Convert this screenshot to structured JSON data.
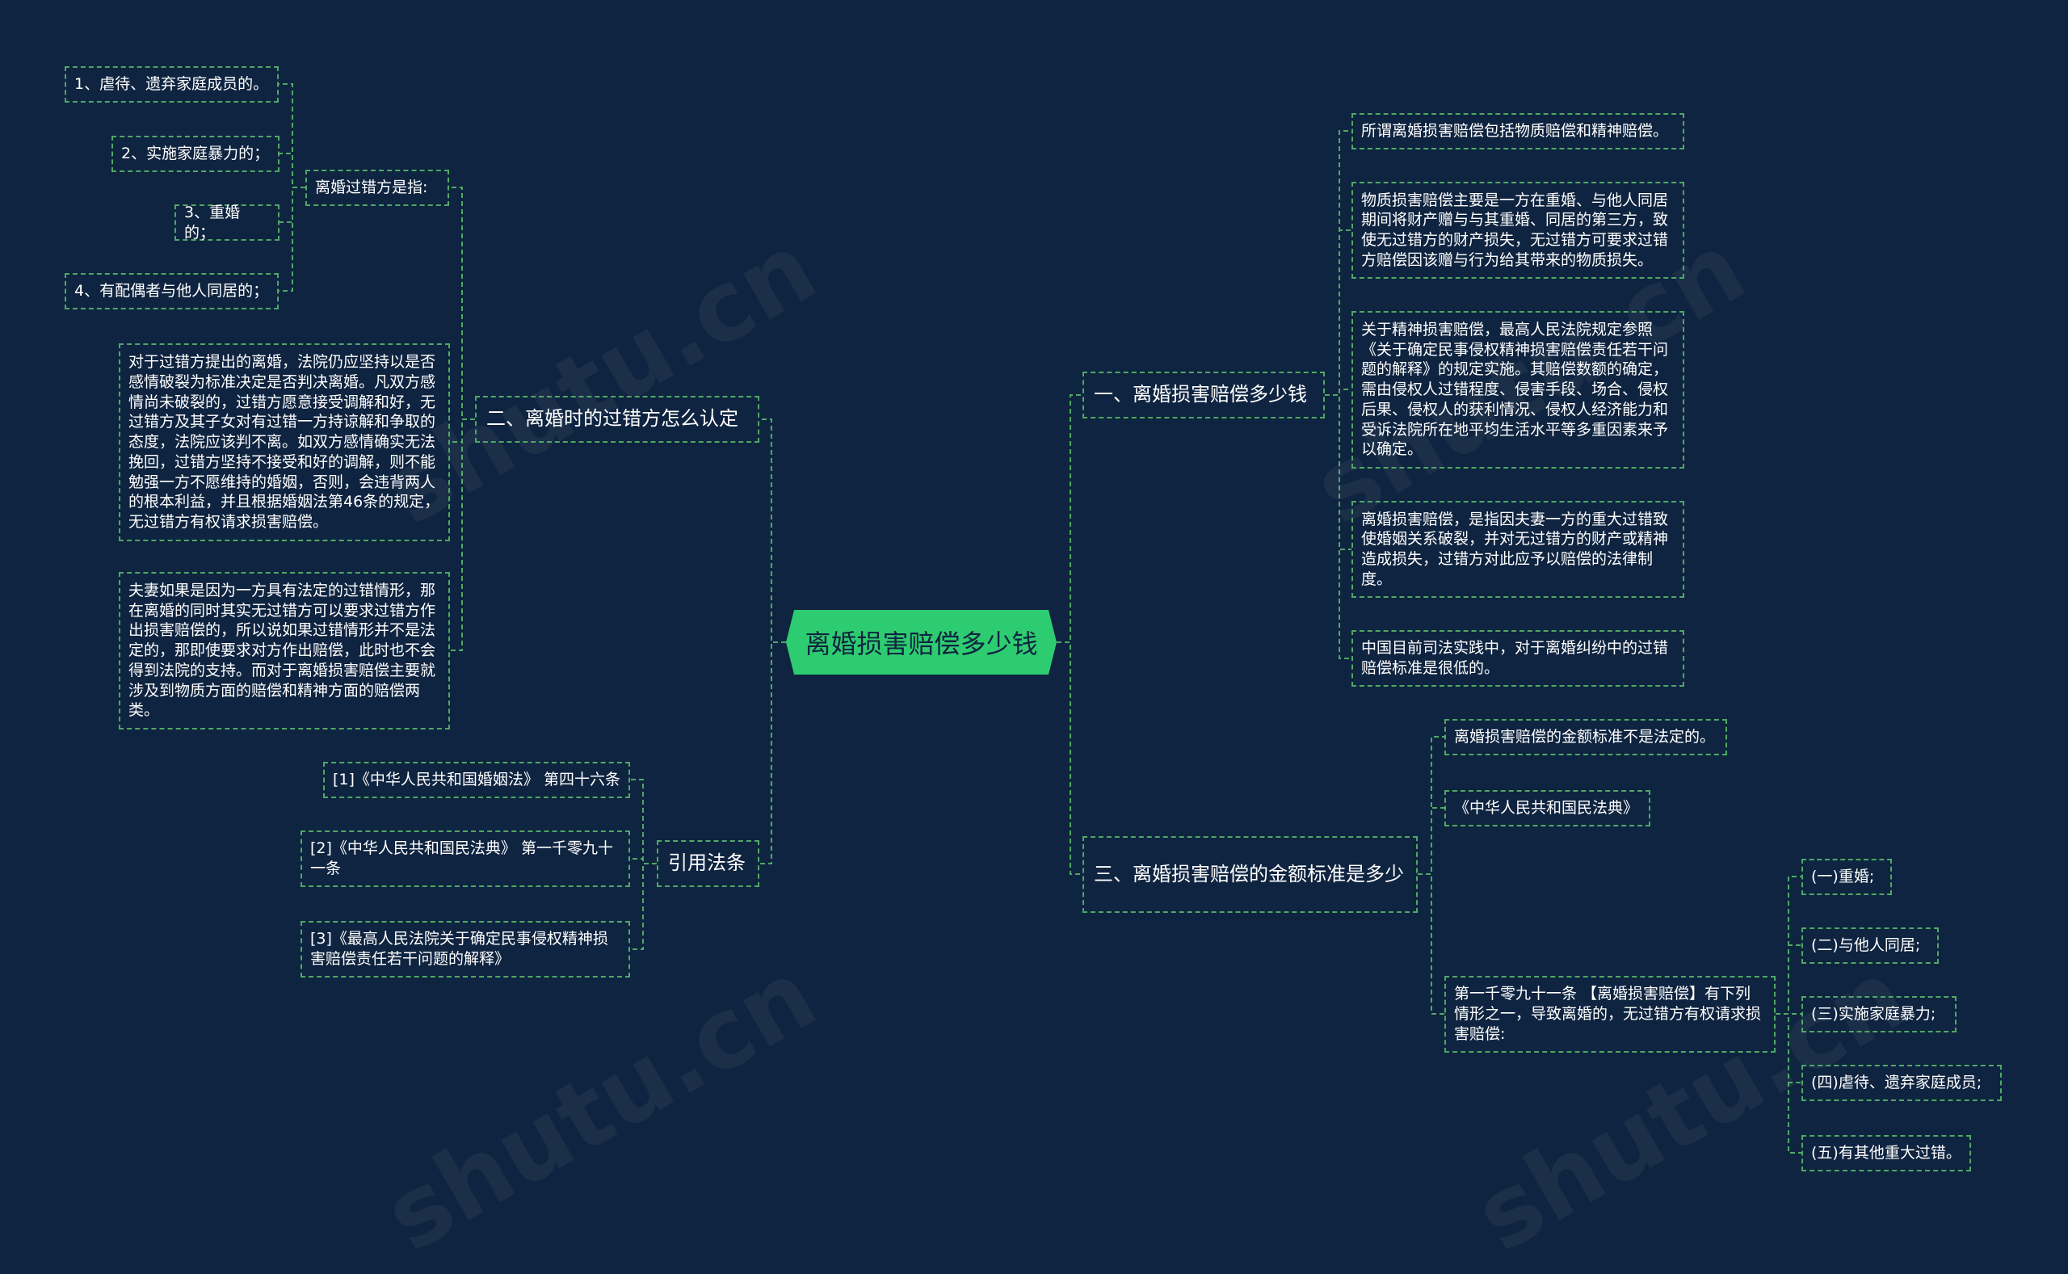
{
  "root": {
    "label": "离婚损害赔偿多少钱"
  },
  "branches": {
    "b1": {
      "label": "一、离婚损害赔偿多少钱",
      "children": [
        "所谓离婚损害赔偿包括物质赔偿和精神赔偿。",
        "物质损害赔偿主要是一方在重婚、与他人同居期间将财产赠与与其重婚、同居的第三方，致使无过错方的财产损失，无过错方可要求过错方赔偿因该赠与行为给其带来的物质损失。",
        "关于精神损害赔偿，最高人民法院规定参照《关于确定民事侵权精神损害赔偿责任若干问题的解释》的规定实施。其赔偿数额的确定，需由侵权人过错程度、侵害手段、场合、侵权后果、侵权人的获利情况、侵权人经济能力和受诉法院所在地平均生活水平等多重因素来予以确定。",
        "离婚损害赔偿，是指因夫妻一方的重大过错致使婚姻关系破裂，并对无过错方的财产或精神造成损失，过错方对此应予以赔偿的法律制度。",
        "中国目前司法实践中，对于离婚纠纷中的过错赔偿标准是很低的。"
      ]
    },
    "b2": {
      "label": "二、离婚时的过错方怎么认定",
      "sub": {
        "label": "离婚过错方是指:",
        "children": [
          "1、虐待、遗弃家庭成员的。",
          "2、实施家庭暴力的；",
          "3、重婚的；",
          "4、有配偶者与他人同居的；"
        ]
      },
      "texts": [
        "对于过错方提出的离婚，法院仍应坚持以是否感情破裂为标准决定是否判决离婚。凡双方感情尚未破裂的，过错方愿意接受调解和好，无过错方及其子女对有过错一方持谅解和争取的态度，法院应该判不离。如双方感情确实无法挽回，过错方坚持不接受和好的调解，则不能勉强一方不愿维持的婚姻，否则，会违背两人的根本利益，并且根据婚姻法第46条的规定，无过错方有权请求损害赔偿。",
        "夫妻如果是因为一方具有法定的过错情形，那在离婚的同时其实无过错方可以要求过错方作出损害赔偿的，所以说如果过错情形并不是法定的，那即使要求对方作出赔偿，此时也不会得到法院的支持。而对于离婚损害赔偿主要就涉及到物质方面的赔偿和精神方面的赔偿两类。"
      ]
    },
    "b3": {
      "label": "三、离婚损害赔偿的金额标准是多少",
      "children": [
        "离婚损害赔偿的金额标准不是法定的。",
        "《中华人民共和国民法典》"
      ],
      "sub": {
        "label": "第一千零九十一条 【离婚损害赔偿】有下列情形之一，导致离婚的，无过错方有权请求损害赔偿:",
        "children": [
          "(一)重婚;",
          "(二)与他人同居;",
          "(三)实施家庭暴力;",
          "(四)虐待、遗弃家庭成员;",
          "(五)有其他重大过错。"
        ]
      }
    },
    "b4": {
      "label": "引用法条",
      "children": [
        "[1]《中华人民共和国婚姻法》 第四十六条",
        "[2]《中华人民共和国民法典》 第一千零九十一条",
        "[3]《最高人民法院关于确定民事侵权精神损害赔偿责任若干问题的解释》"
      ]
    }
  },
  "watermark": "shutu.cn",
  "colors": {
    "background": "#0f2440",
    "root": "#2ecc71",
    "border": "#4fa865",
    "line": "#4fa865"
  }
}
